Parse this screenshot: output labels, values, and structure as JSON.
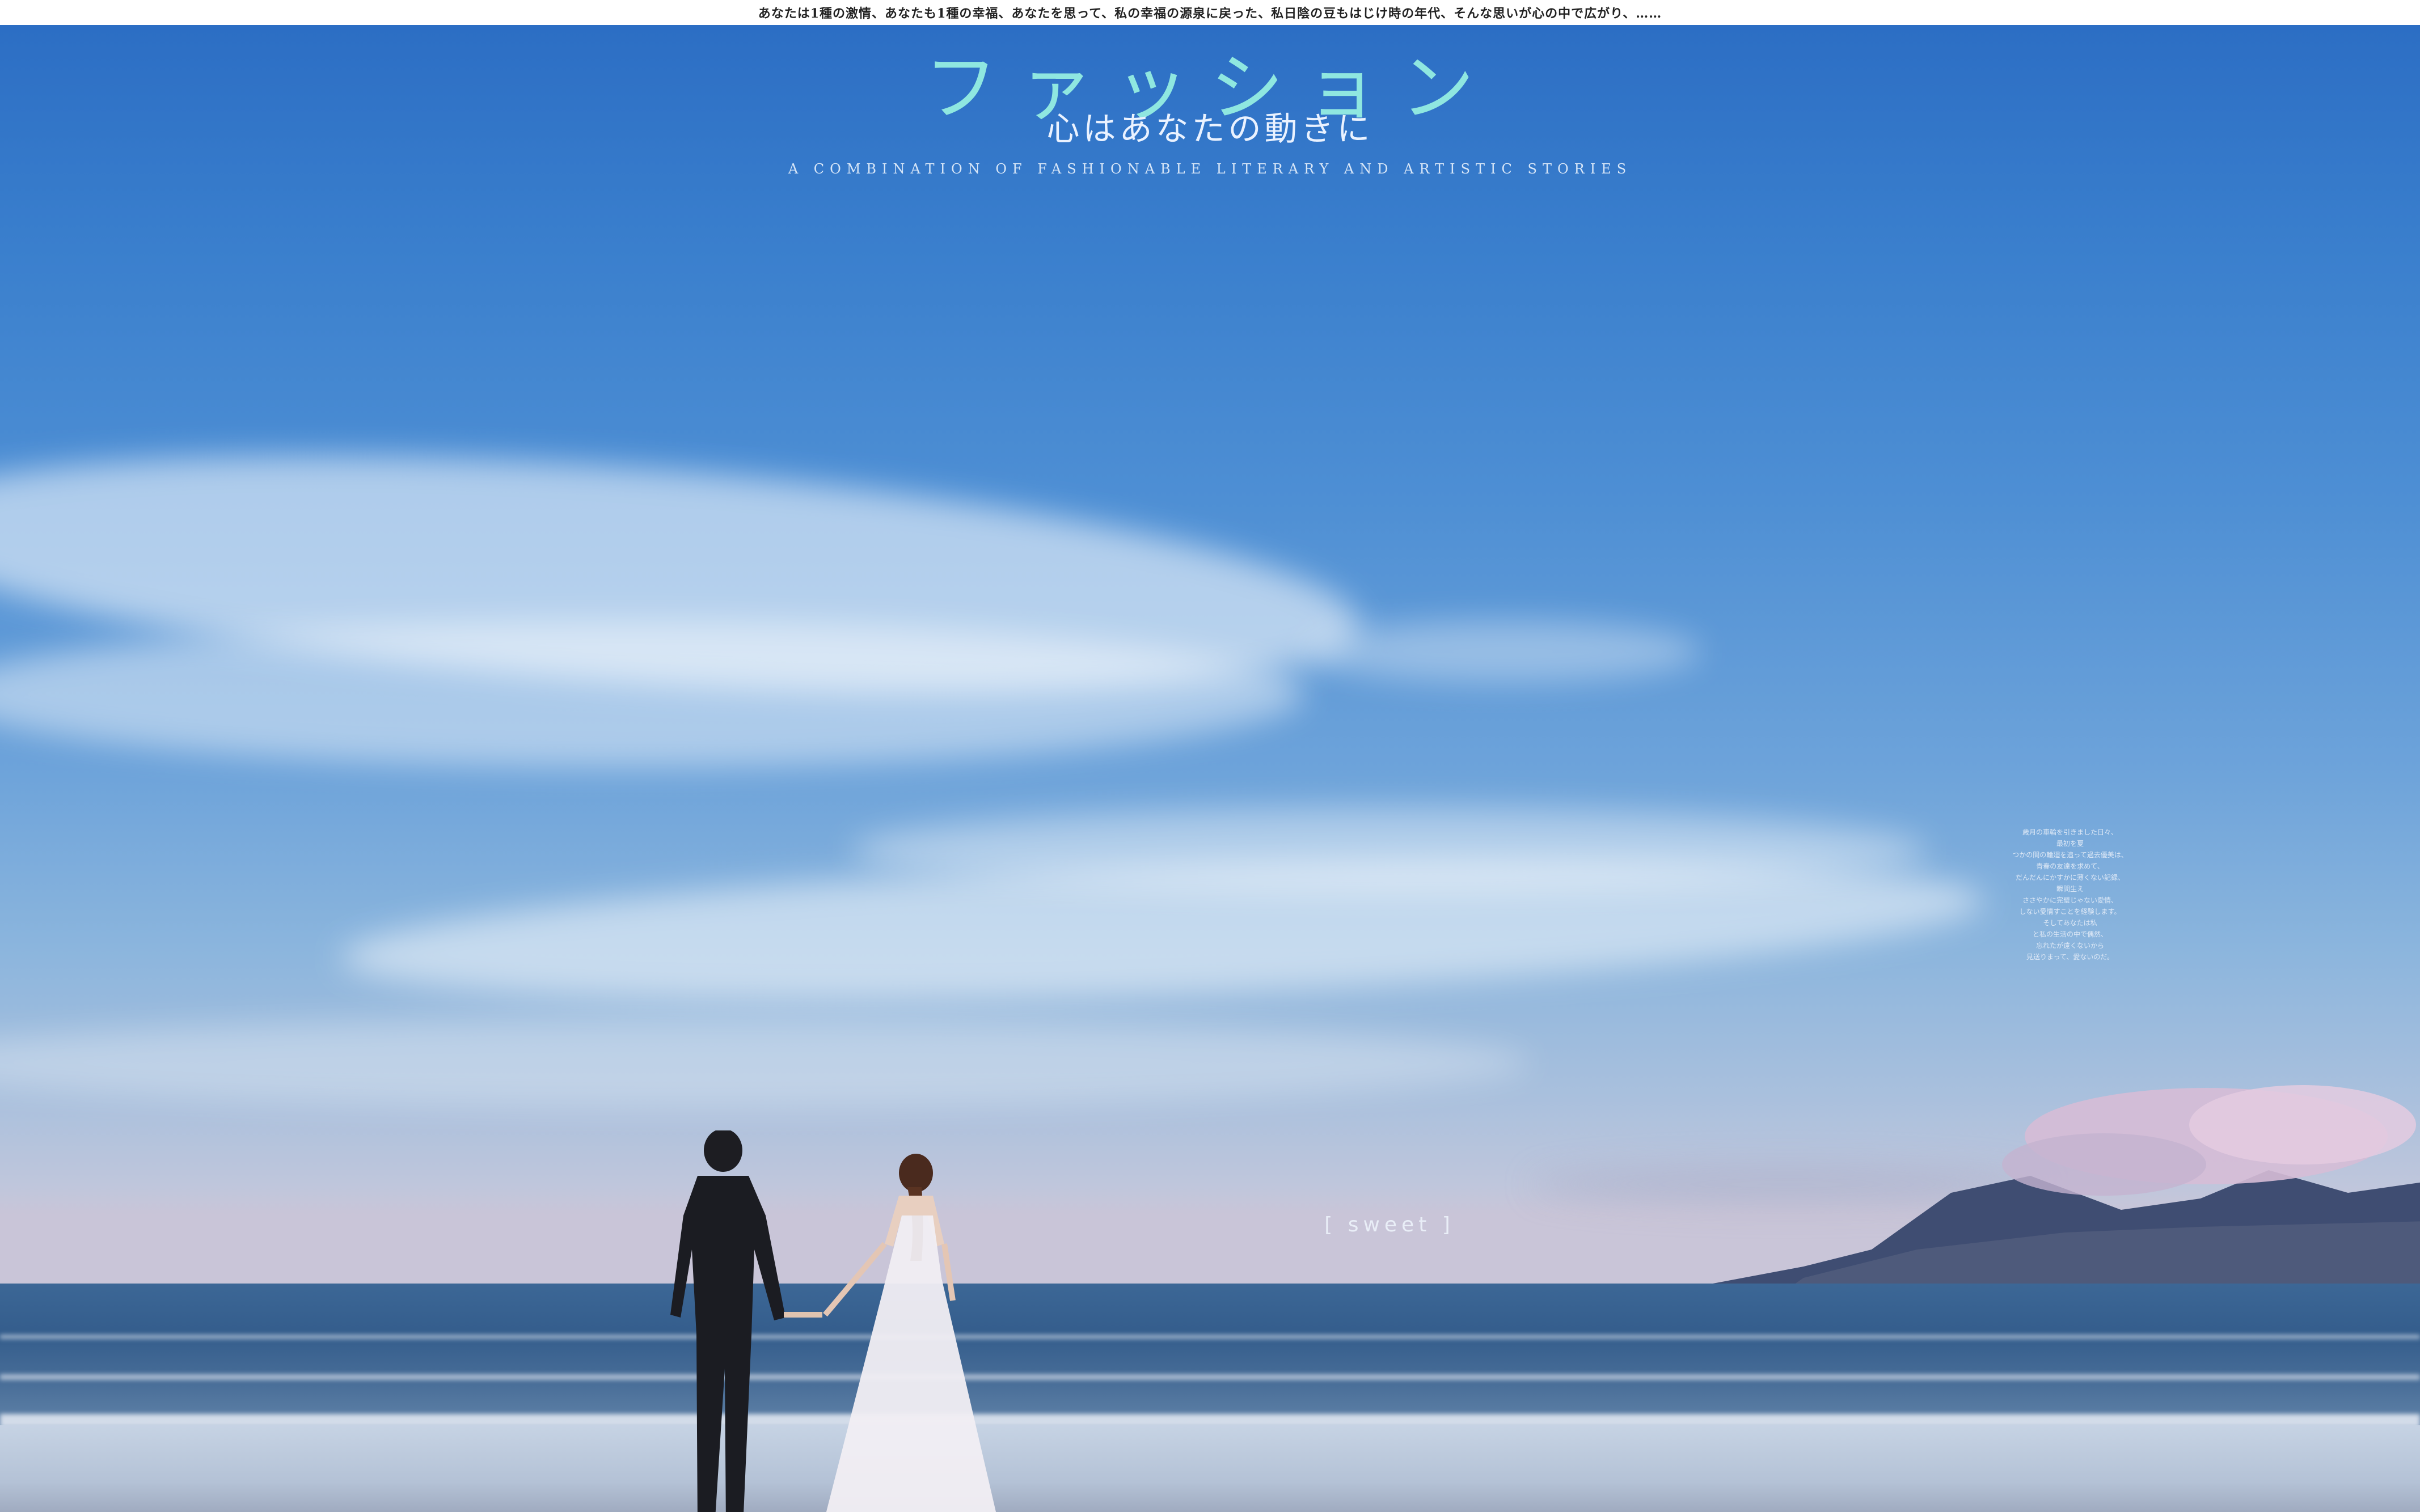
{
  "header": {
    "strip_text": "あなたは1種の激情、あなたも1種の幸福、あなたを思って、私の幸福の源泉に戻った、私日陰の豆もはじけ時の年代、そんな思いが心の中で広がり、……"
  },
  "poster": {
    "title": "ファッション",
    "subtitle": "心はあなたの動きに",
    "tagline": "A COMBINATION OF FASHIONABLE LITERARY AND ARTISTIC STORIES",
    "sweet_label": "[ sweet ]",
    "poem_lines": [
      "歳月の車輪を引きました日々、",
      "最初を夏",
      "つかの間の輪廻を追って過去優美は、",
      "青春の友達を求めて、",
      "だんだんにかすかに薄くない記録、",
      "瞬間生え",
      "ささやかに完璧じゃない愛情、",
      "しない愛情すことを経験します。",
      "そしてあなたは私",
      "と私の生活の中で偶然、",
      "忘れたが遠くないから",
      "見送りまって、愛ないのだ。"
    ],
    "title_color": "#8fe7e0"
  }
}
